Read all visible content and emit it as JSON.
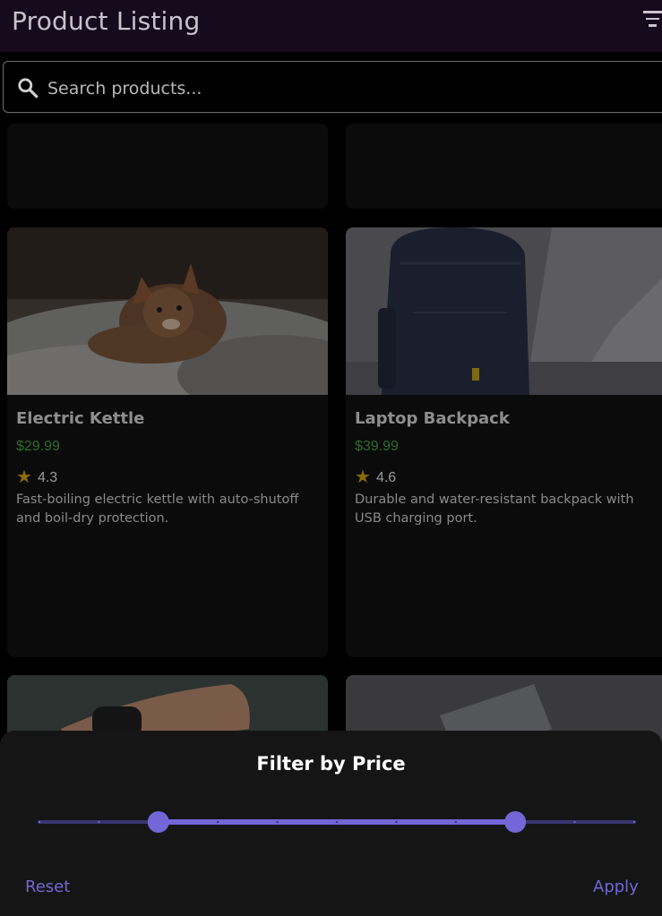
{
  "appbar": {
    "title": "Product Listing",
    "filter_icon": "filter-list-icon"
  },
  "search": {
    "placeholder": "Search products...",
    "icon": "search-icon"
  },
  "products": [
    {
      "title": "Electric Kettle",
      "price": "$29.99",
      "rating": "4.3",
      "description": "Fast-boiling electric kettle with auto-shutoff and boil-dry protection.",
      "image": "kitten-photo"
    },
    {
      "title": "Laptop Backpack",
      "price": "$39.99",
      "rating": "4.6",
      "description": "Durable and water-resistant backpack with USB charging port.",
      "image": "backpack-photo"
    }
  ],
  "filter_sheet": {
    "title": "Filter by Price",
    "reset_label": "Reset",
    "apply_label": "Apply",
    "range_start_fraction": 0.2,
    "range_end_fraction": 0.8,
    "divisions": 10
  },
  "colors": {
    "accent": "#7466d6",
    "price": "#2f6b2a",
    "star": "#8a6a0a",
    "appbar": "#170a1c"
  }
}
